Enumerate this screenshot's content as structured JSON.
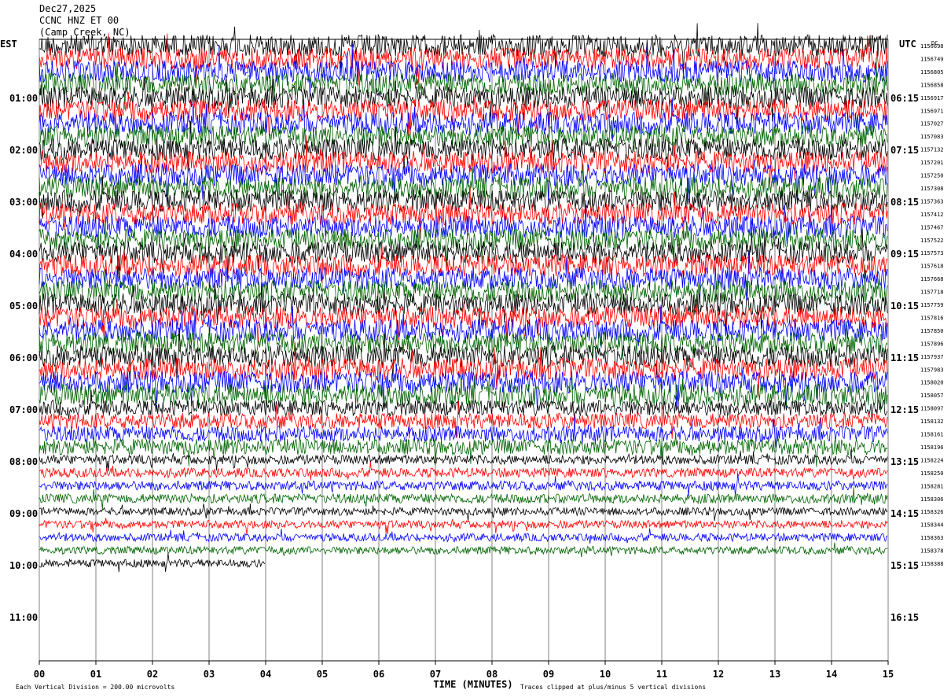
{
  "header": {
    "date": "Dec27,2025",
    "station": "CCNC HNZ ET 00",
    "location": "(Camp Creek, NC)"
  },
  "axis": {
    "left_timezone": "EST",
    "right_timezone": "UTC",
    "dc_label": "DC",
    "xlabel": "TIME (MINUTES)",
    "left_hours": [
      "01:00",
      "02:00",
      "03:00",
      "04:00",
      "05:00",
      "06:00",
      "07:00",
      "08:00",
      "09:00",
      "10:00",
      "11:00"
    ],
    "right_hours": [
      "06:15",
      "07:15",
      "08:15",
      "09:15",
      "10:15",
      "11:15",
      "12:15",
      "13:15",
      "14:15",
      "15:15",
      "16:15"
    ],
    "minute_ticks": [
      "00",
      "01",
      "02",
      "03",
      "04",
      "05",
      "06",
      "07",
      "08",
      "09",
      "10",
      "11",
      "12",
      "13",
      "14",
      "15"
    ]
  },
  "footer": {
    "scale_note": "Each Vertical Division =  200.00 microvolts",
    "clip_note": "Traces clipped at plus/minus 5 vertical divisions"
  },
  "colors": {
    "trace_cycle": [
      "#000000",
      "#ff0000",
      "#0000ff",
      "#006400"
    ],
    "grid": "#808080",
    "background": "#ffffff"
  },
  "chart_data": {
    "type": "line",
    "title": "CCNC HNZ ET 00",
    "xlabel": "TIME (MINUTES)",
    "xlim": [
      0,
      15
    ],
    "minutes_per_line": 15,
    "lines_per_hour": 4,
    "grid": true,
    "dc_offsets": [
      1156698,
      1156749,
      1156805,
      1156858,
      1156917,
      1156971,
      1157027,
      1157083,
      1157132,
      1157201,
      1157250,
      1157308,
      1157363,
      1157412,
      1157467,
      1157522,
      1157573,
      1157618,
      1157668,
      1157718,
      1157759,
      1157816,
      1157850,
      1157896,
      1157937,
      1157983,
      1158020,
      1158057,
      1158097,
      1158132,
      1158161,
      1158196,
      1158224,
      1158250,
      1158281,
      1158306,
      1158326,
      1158344,
      1158363,
      1158378,
      1158388
    ],
    "last_line_end_minute": 4
  }
}
